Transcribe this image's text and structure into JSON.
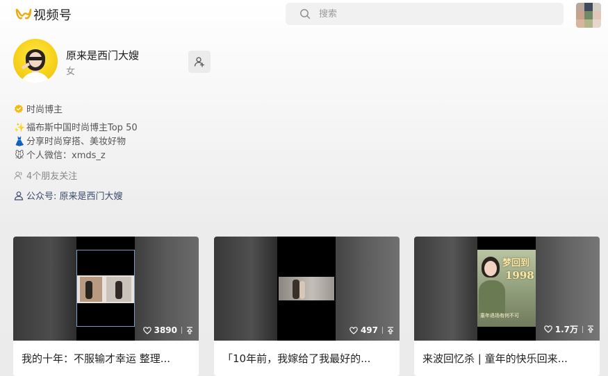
{
  "header": {
    "logo_text": "视频号",
    "search_placeholder": "搜索"
  },
  "profile": {
    "name": "原来是西门大嫂",
    "gender": "女",
    "certification": "时尚博主",
    "bio": [
      {
        "icon": "✨",
        "text": "福布斯中国时尚博主Top 50"
      },
      {
        "icon": "👗",
        "text": "分享时尚穿搭、美妆好物"
      },
      {
        "icon": "🐭",
        "text": "个人微信：xmds_z"
      }
    ],
    "friends_following": "4个朋友关注",
    "official_account": "公众号: 原来是西门大嫂"
  },
  "videos": [
    {
      "title": "我的十年：不服输才幸运 整理...",
      "likes": "3890"
    },
    {
      "title": "「10年前，我嫁给了我最好的...",
      "likes": "497"
    },
    {
      "title": "来波回忆杀 | 童年的快乐回来...",
      "likes": "1.7万",
      "thumb_text": [
        "梦回到",
        "1998",
        "童年退场有何不可"
      ]
    }
  ],
  "colors": {
    "accent_yellow": "#f5b90a",
    "link_blue": "#3b4a6b"
  }
}
